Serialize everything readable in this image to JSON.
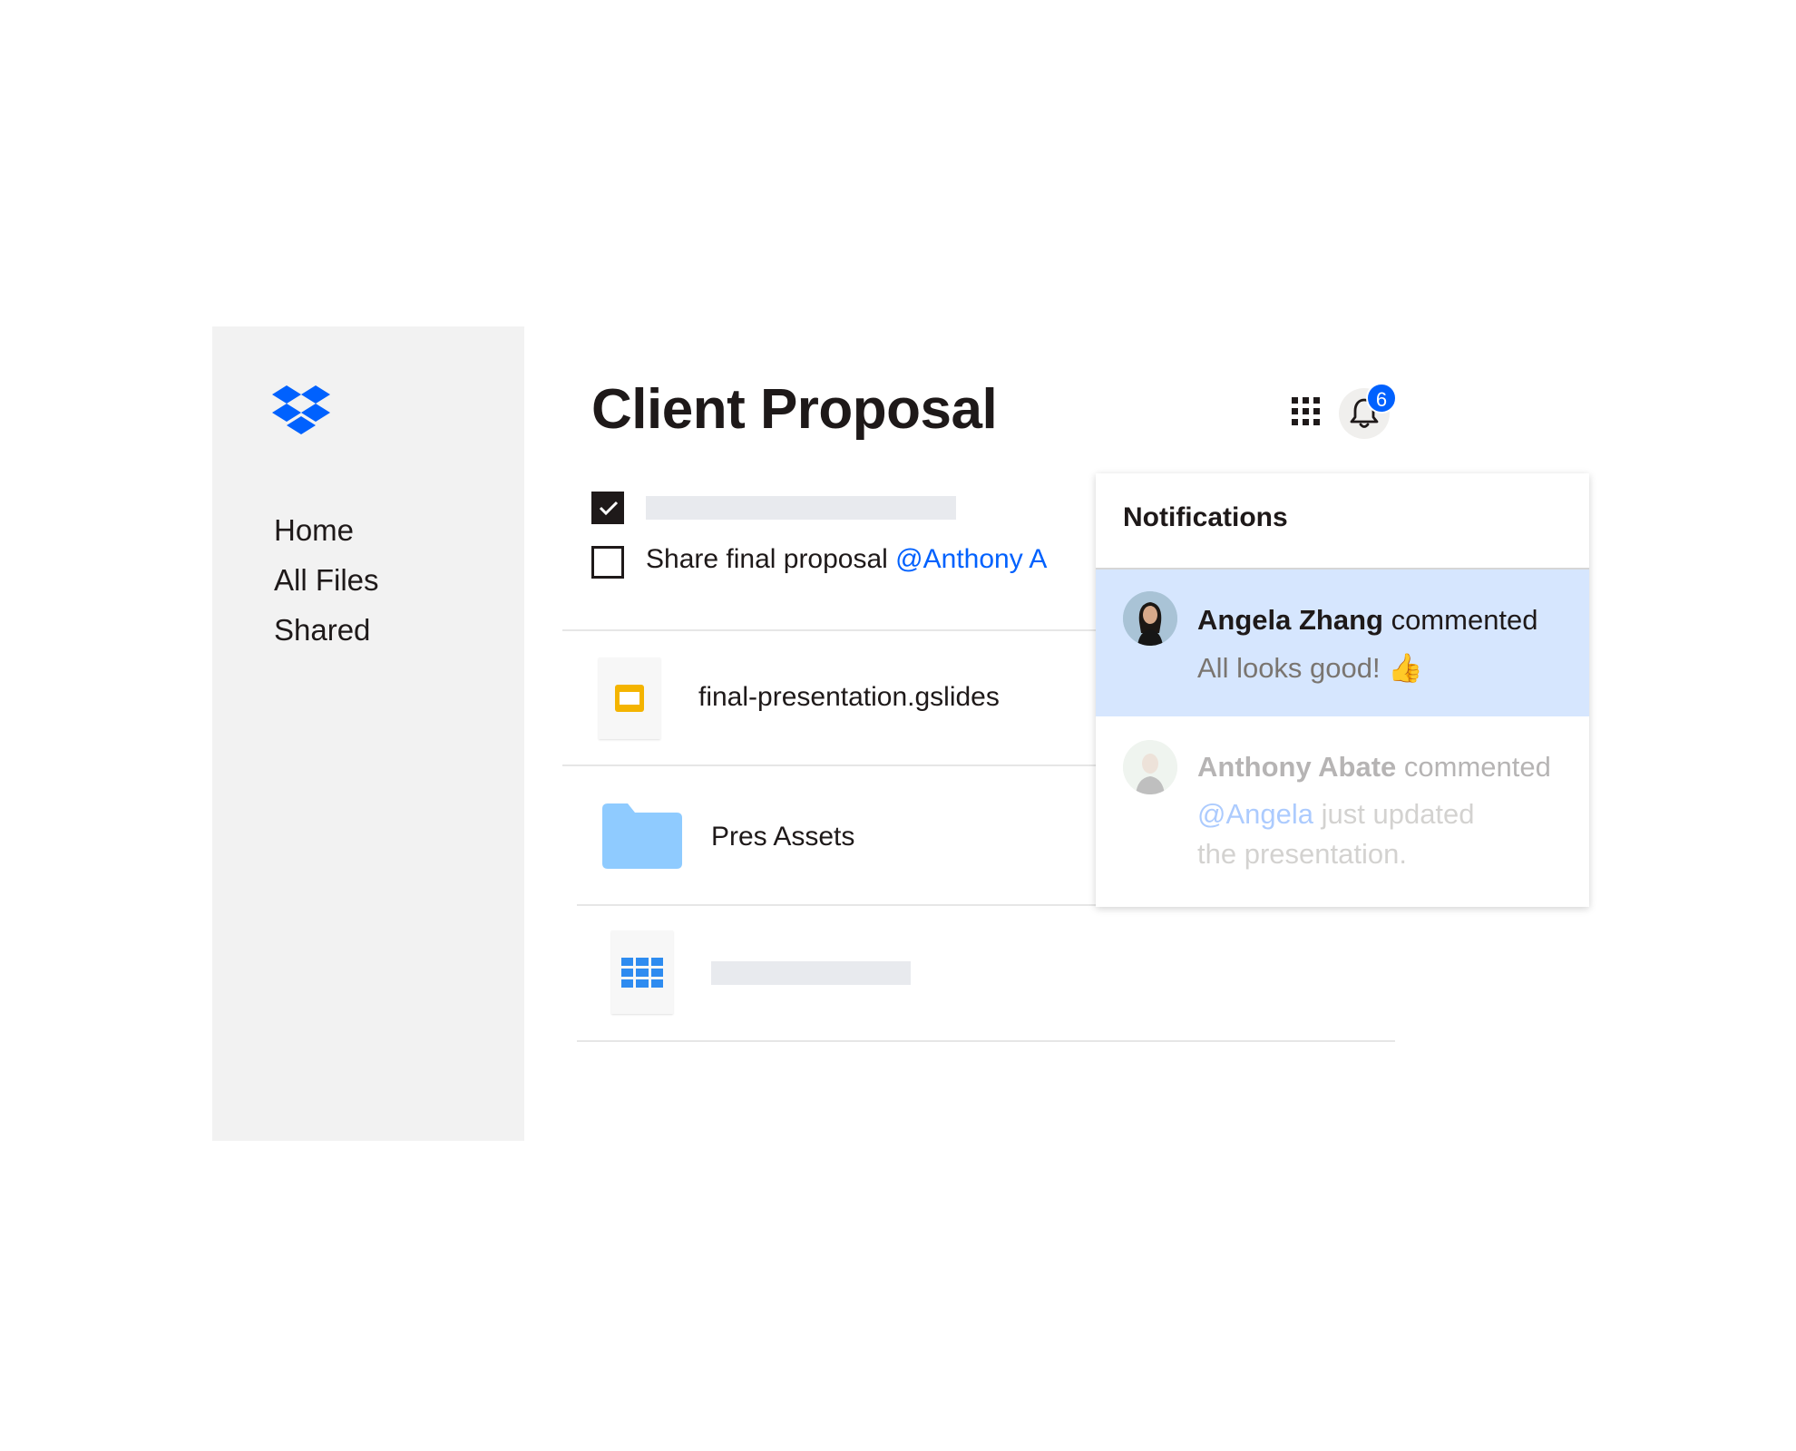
{
  "brand": {
    "logo": "dropbox-logo",
    "accent": "#0061fe"
  },
  "sidebar": {
    "items": [
      {
        "label": "Home"
      },
      {
        "label": "All Files"
      },
      {
        "label": "Shared"
      }
    ]
  },
  "header": {
    "title": "Client Proposal",
    "apps_icon": "grid-icon",
    "bell_icon": "bell-icon",
    "notification_count": "6"
  },
  "tasks": [
    {
      "checked": true,
      "text": ""
    },
    {
      "checked": false,
      "text": "Share final proposal ",
      "mention": "@Anthony A"
    }
  ],
  "files": [
    {
      "icon": "slides-icon",
      "name": "final-presentation.gslides",
      "icon_color": "#f4b400"
    },
    {
      "icon": "folder-icon",
      "name": "Pres Assets",
      "icon_color": "#8fcbff"
    },
    {
      "icon": "sheet-icon",
      "name": "",
      "icon_color": "#2e8cf0"
    }
  ],
  "notifications": {
    "title": "Notifications",
    "items": [
      {
        "name": "Angela Zhang",
        "action": " commented",
        "message": "All looks good! 👍",
        "active": true
      },
      {
        "name": "Anthony Abate",
        "action": " commented",
        "mention": "@Angela",
        "message": " just updated",
        "message_line2": "the presentation.",
        "active": false
      }
    ]
  }
}
